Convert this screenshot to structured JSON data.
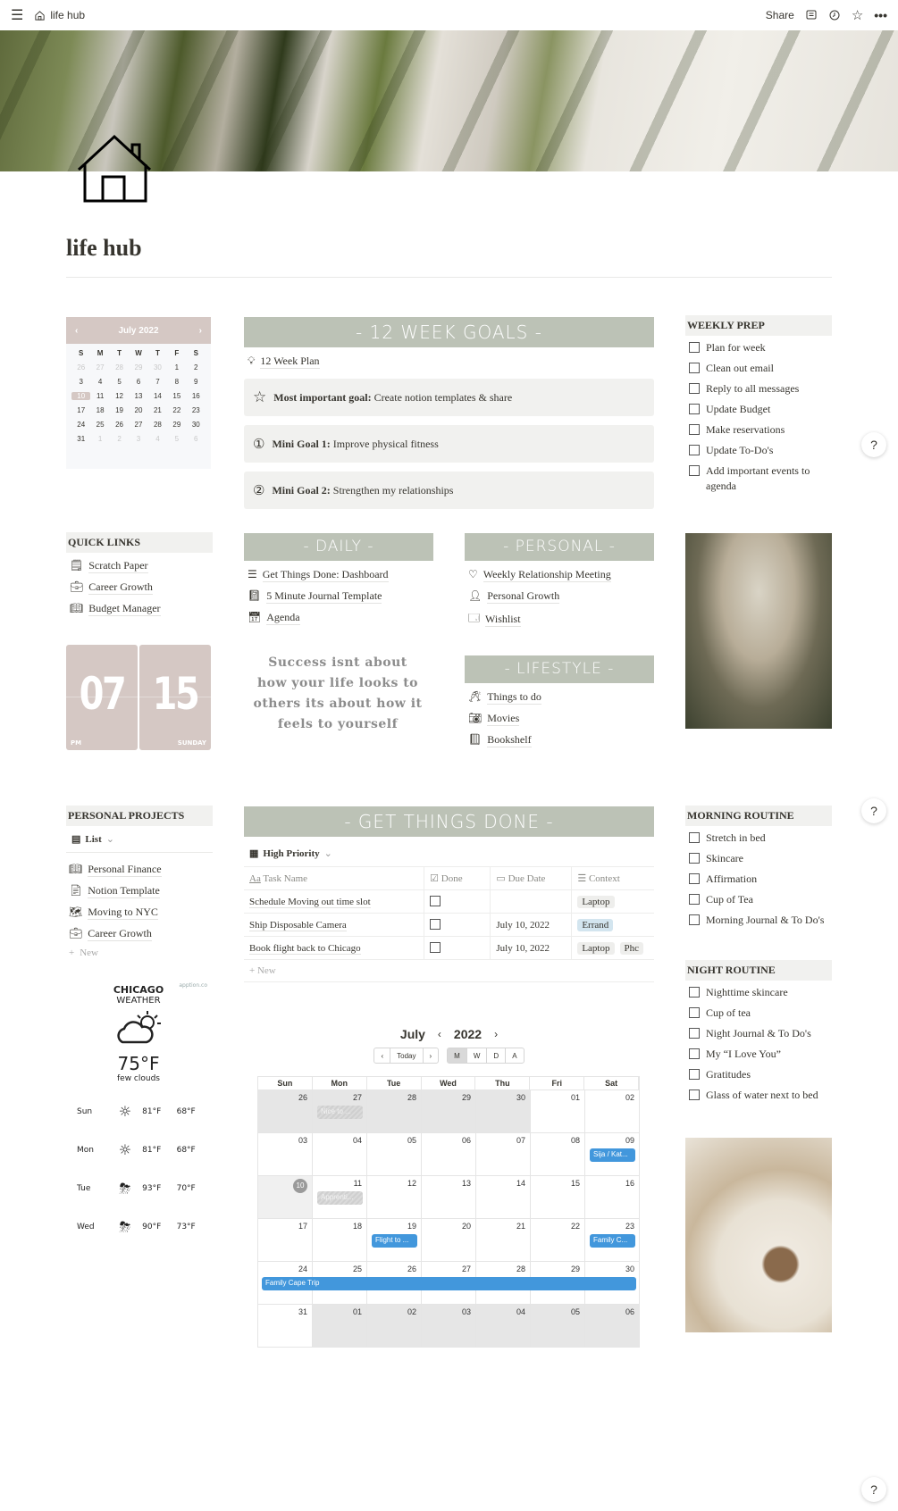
{
  "topbar": {
    "breadcrumb": "life hub",
    "share_label": "Share"
  },
  "page": {
    "title": "life hub"
  },
  "mini_calendar": {
    "month_label": "July 2022",
    "dow": [
      "S",
      "M",
      "T",
      "W",
      "T",
      "F",
      "S"
    ],
    "weeks": [
      [
        {
          "d": "26",
          "m": true
        },
        {
          "d": "27",
          "m": true
        },
        {
          "d": "28",
          "m": true
        },
        {
          "d": "29",
          "m": true
        },
        {
          "d": "30",
          "m": true
        },
        {
          "d": "1"
        },
        {
          "d": "2"
        }
      ],
      [
        {
          "d": "3"
        },
        {
          "d": "4"
        },
        {
          "d": "5"
        },
        {
          "d": "6"
        },
        {
          "d": "7"
        },
        {
          "d": "8"
        },
        {
          "d": "9"
        }
      ],
      [
        {
          "d": "10",
          "t": true
        },
        {
          "d": "11"
        },
        {
          "d": "12"
        },
        {
          "d": "13"
        },
        {
          "d": "14"
        },
        {
          "d": "15"
        },
        {
          "d": "16"
        }
      ],
      [
        {
          "d": "17"
        },
        {
          "d": "18"
        },
        {
          "d": "19"
        },
        {
          "d": "20"
        },
        {
          "d": "21"
        },
        {
          "d": "22"
        },
        {
          "d": "23"
        }
      ],
      [
        {
          "d": "24"
        },
        {
          "d": "25"
        },
        {
          "d": "26"
        },
        {
          "d": "27"
        },
        {
          "d": "28"
        },
        {
          "d": "29"
        },
        {
          "d": "30"
        }
      ],
      [
        {
          "d": "31"
        },
        {
          "d": "1",
          "m": true
        },
        {
          "d": "2",
          "m": true
        },
        {
          "d": "3",
          "m": true
        },
        {
          "d": "4",
          "m": true
        },
        {
          "d": "5",
          "m": true
        },
        {
          "d": "6",
          "m": true
        }
      ]
    ]
  },
  "goals": {
    "banner": "- 12 WEEK GOALS -",
    "plan_link": "12 Week Plan",
    "callouts": [
      {
        "bold": "Most important goal:",
        "text": " Create notion templates & share"
      },
      {
        "bold": "Mini Goal 1:",
        "text": " Improve physical fitness"
      },
      {
        "bold": "Mini Goal 2:",
        "text": " Strengthen my relationships"
      }
    ]
  },
  "weekly_prep": {
    "heading": "WEEKLY PREP",
    "items": [
      "Plan for week",
      "Clean out email",
      "Reply to all messages",
      "Update Budget",
      "Make reservations",
      "Update To-Do's",
      "Add important events to agenda"
    ]
  },
  "quick_links": {
    "heading": "QUICK LINKS",
    "items": [
      "Scratch Paper",
      "Career Growth",
      "Budget Manager"
    ]
  },
  "clock": {
    "hour": "07",
    "minute": "15",
    "ampm": "PM",
    "day": "SUNDAY"
  },
  "daily": {
    "banner": "- DAILY -",
    "items": [
      "Get Things Done: Dashboard",
      "5 Minute Journal Template",
      "Agenda"
    ]
  },
  "quote": "Success isnt about how your life looks to others its about how it feels to yourself",
  "personal": {
    "banner": "- PERSONAL -",
    "items": [
      "Weekly Relationship Meeting",
      "Personal Growth",
      "Wishlist"
    ]
  },
  "lifestyle": {
    "banner": "- LIFESTYLE -",
    "items": [
      "Things to do",
      "Movies",
      "Bookshelf"
    ]
  },
  "personal_projects": {
    "heading": "PERSONAL PROJECTS",
    "view_label": "List",
    "items": [
      "Personal Finance",
      "Notion Template",
      "Moving to NYC",
      "Career Growth"
    ],
    "new_label": "New"
  },
  "weather": {
    "credit": "apption.co",
    "city": "CHICAGO",
    "subtitle": "WEATHER",
    "temp": "75°F",
    "desc": "few clouds",
    "forecast": [
      {
        "day": "Sun",
        "icon": "sun",
        "high": "81°F",
        "low": "68°F"
      },
      {
        "day": "Mon",
        "icon": "sun",
        "high": "81°F",
        "low": "68°F"
      },
      {
        "day": "Tue",
        "icon": "storm",
        "high": "93°F",
        "low": "70°F"
      },
      {
        "day": "Wed",
        "icon": "storm",
        "high": "90°F",
        "low": "73°F"
      }
    ]
  },
  "gtd": {
    "banner": "- GET THINGS DONE -",
    "view_label": "High Priority",
    "columns": [
      "Task Name",
      "Done",
      "Due Date",
      "Context"
    ],
    "rows": [
      {
        "task": "Schedule Moving out time slot",
        "done": false,
        "due": "",
        "tags": [
          {
            "t": "Laptop",
            "c": "gray"
          }
        ]
      },
      {
        "task": "Ship Disposable Camera",
        "done": false,
        "due": "July 10, 2022",
        "tags": [
          {
            "t": "Errand",
            "c": "blue"
          }
        ]
      },
      {
        "task": "Book flight back to Chicago",
        "done": false,
        "due": "July 10, 2022",
        "tags": [
          {
            "t": "Laptop",
            "c": "gray"
          },
          {
            "t": "Phc",
            "c": "gray"
          }
        ]
      }
    ],
    "new_label": "New"
  },
  "big_calendar": {
    "month": "July",
    "year": "2022",
    "today_label": "Today",
    "views": [
      "M",
      "W",
      "D",
      "A"
    ],
    "active_view": "M",
    "dows": [
      "Sun",
      "Mon",
      "Tue",
      "Wed",
      "Thu",
      "Fri",
      "Sat"
    ],
    "weeks": [
      [
        {
          "d": "26",
          "o": true
        },
        {
          "d": "27",
          "o": true,
          "ev": "Nice to ...",
          "ghost": true
        },
        {
          "d": "28",
          "o": true
        },
        {
          "d": "29",
          "o": true
        },
        {
          "d": "30",
          "o": true
        },
        {
          "d": "01"
        },
        {
          "d": "02"
        }
      ],
      [
        {
          "d": "03"
        },
        {
          "d": "04"
        },
        {
          "d": "05"
        },
        {
          "d": "06"
        },
        {
          "d": "07"
        },
        {
          "d": "08"
        },
        {
          "d": "09",
          "ev": "Sija / Kat..."
        }
      ],
      [
        {
          "d": "10",
          "today": true
        },
        {
          "d": "11",
          "ev": "Apprenti...",
          "ghost": true
        },
        {
          "d": "12"
        },
        {
          "d": "13"
        },
        {
          "d": "14"
        },
        {
          "d": "15"
        },
        {
          "d": "16"
        }
      ],
      [
        {
          "d": "17"
        },
        {
          "d": "18"
        },
        {
          "d": "19",
          "ev": "Flight to ..."
        },
        {
          "d": "20"
        },
        {
          "d": "21"
        },
        {
          "d": "22"
        },
        {
          "d": "23",
          "ev": "Family C..."
        }
      ],
      [
        {
          "d": "24"
        },
        {
          "d": "25"
        },
        {
          "d": "26"
        },
        {
          "d": "27"
        },
        {
          "d": "28"
        },
        {
          "d": "29"
        },
        {
          "d": "30"
        }
      ],
      [
        {
          "d": "31"
        },
        {
          "d": "01",
          "o": true
        },
        {
          "d": "02",
          "o": true
        },
        {
          "d": "03",
          "o": true
        },
        {
          "d": "04",
          "o": true
        },
        {
          "d": "05",
          "o": true
        },
        {
          "d": "06",
          "o": true
        }
      ]
    ],
    "span_event": {
      "label": "Family Cape Trip",
      "week": 4
    }
  },
  "morning_routine": {
    "heading": "MORNING ROUTINE",
    "items": [
      "Stretch in bed",
      "Skincare",
      "Affirmation",
      "Cup of Tea",
      "Morning Journal & To Do's"
    ]
  },
  "night_routine": {
    "heading": "NIGHT ROUTINE",
    "items": [
      "Nighttime skincare",
      "Cup of tea",
      "Night Journal & To Do's",
      "My “I Love You”",
      "Gratitudes",
      "Glass of water next to bed"
    ]
  },
  "help_label": "?"
}
